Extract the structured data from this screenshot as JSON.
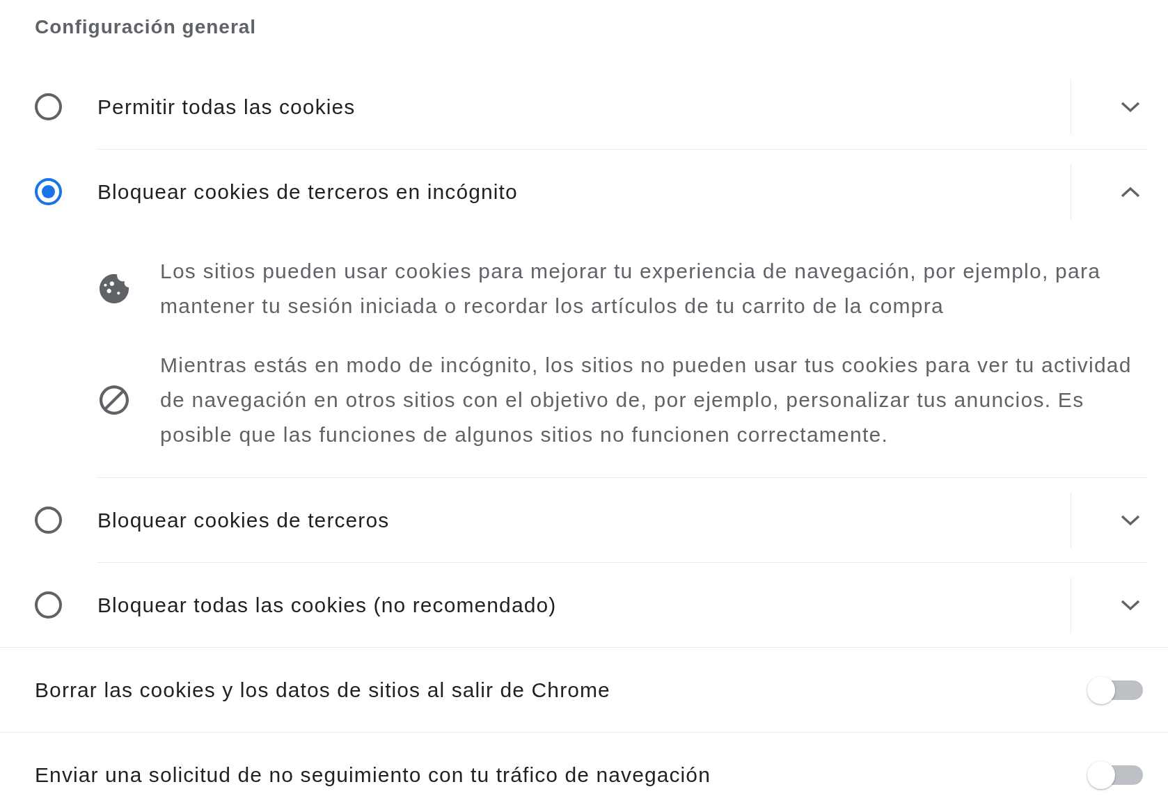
{
  "section_title": "Configuración general",
  "cookie_options": [
    {
      "label": "Permitir todas las cookies",
      "selected": false,
      "expanded": false
    },
    {
      "label": "Bloquear cookies de terceros en incógnito",
      "selected": true,
      "expanded": true,
      "details": [
        {
          "kind": "cookie",
          "text": "Los sitios pueden usar cookies para mejorar tu experiencia de navegación, por ejemplo, para mantener tu sesión iniciada o recordar los artículos de tu carrito de la compra"
        },
        {
          "kind": "blocked",
          "text": "Mientras estás en modo de incógnito, los sitios no pueden usar tus cookies para ver tu actividad de navegación en otros sitios con el objetivo de, por ejemplo, personalizar tus anuncios. Es posible que las funciones de algunos sitios no funcionen correctamente."
        }
      ]
    },
    {
      "label": "Bloquear cookies de terceros",
      "selected": false,
      "expanded": false
    },
    {
      "label": "Bloquear todas las cookies (no recomendado)",
      "selected": false,
      "expanded": false
    }
  ],
  "toggles": [
    {
      "label": "Borrar las cookies y los datos de sitios al salir de Chrome",
      "on": false
    },
    {
      "label": "Enviar una solicitud de no seguimiento con tu tráfico de navegación",
      "on": false
    }
  ]
}
